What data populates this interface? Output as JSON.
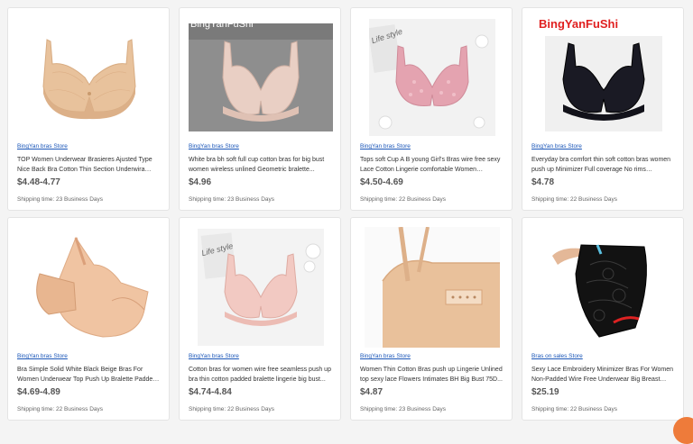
{
  "products": [
    {
      "store": "BingYan bras Store",
      "title": "TOP Women Underwear Brasieres Ajusted Type Nice Back Bra Cotton Thin Section Underwira Pus...",
      "price": "$4.48-4.77",
      "shipping": "Shipping time: 23 Business Days",
      "image": "nude-lace-bra"
    },
    {
      "store": "BingYan bras Store",
      "title": "White bra bh soft full cup cotton bras for big bust women wireless unlined Geometric bralette...",
      "price": "$4.96",
      "shipping": "Shipping time: 23 Business Days",
      "image": "pink-full-cup-bra",
      "watermark": "BingYanFuShi"
    },
    {
      "store": "BingYan bras Store",
      "title": "Tops soft Cup A B young Girl's Bras wire free sexy Lace Cotton Lingerie comfortable Women Seamle...",
      "price": "$4.50-4.69",
      "shipping": "Shipping time: 22 Business Days",
      "image": "pink-lace-bra",
      "photo_text": "Life style"
    },
    {
      "store": "BingYan bras Store",
      "title": "Everyday bra comfort thin soft cotton bras women push up Minimizer Full coverage No rims underwe...",
      "price": "$4.78",
      "shipping": "Shipping time: 22 Business Days",
      "image": "black-bra",
      "watermark": "BingYanFuShi"
    },
    {
      "store": "BingYan bras Store",
      "title": "Bra Simple Solid White Black Beige Bras For Women Underwear Top Push Up Bralette Padded Cotton...",
      "price": "$4.69-4.89",
      "shipping": "Shipping time: 22 Business Days",
      "image": "beige-bra-side"
    },
    {
      "store": "BingYan bras Store",
      "title": "Cotton bras for women wire free seamless push up bra thin cotton padded bralette lingerie big bust...",
      "price": "$4.74-4.84",
      "shipping": "Shipping time: 22 Business Days",
      "image": "light-pink-bra",
      "photo_text": "Life style"
    },
    {
      "store": "BingYan bras Store",
      "title": "Women Thin Cotton Bras push up Lingerie Unlined top sexy lace Flowers Intimates BH Big Bust 75D...",
      "price": "$4.87",
      "shipping": "Shipping time: 23 Business Days",
      "image": "beige-bra-back"
    },
    {
      "store": "Bras on sales Store",
      "title": "Sexy Lace Embroidery Minimizer Bras For Women Non-Padded Wire Free Underwear Big Breast Lar...",
      "price": "$25.19",
      "shipping": "Shipping time: 22 Business Days",
      "image": "black-lace-bra"
    }
  ],
  "colors": {
    "page_bg": "#f4f4f4",
    "card_bg": "#ffffff",
    "store_link": "#1a56b8",
    "price": "#555555",
    "watermark_white": "#ffffff",
    "watermark_red": "#e02020",
    "chat_button": "#ee7b3a"
  }
}
